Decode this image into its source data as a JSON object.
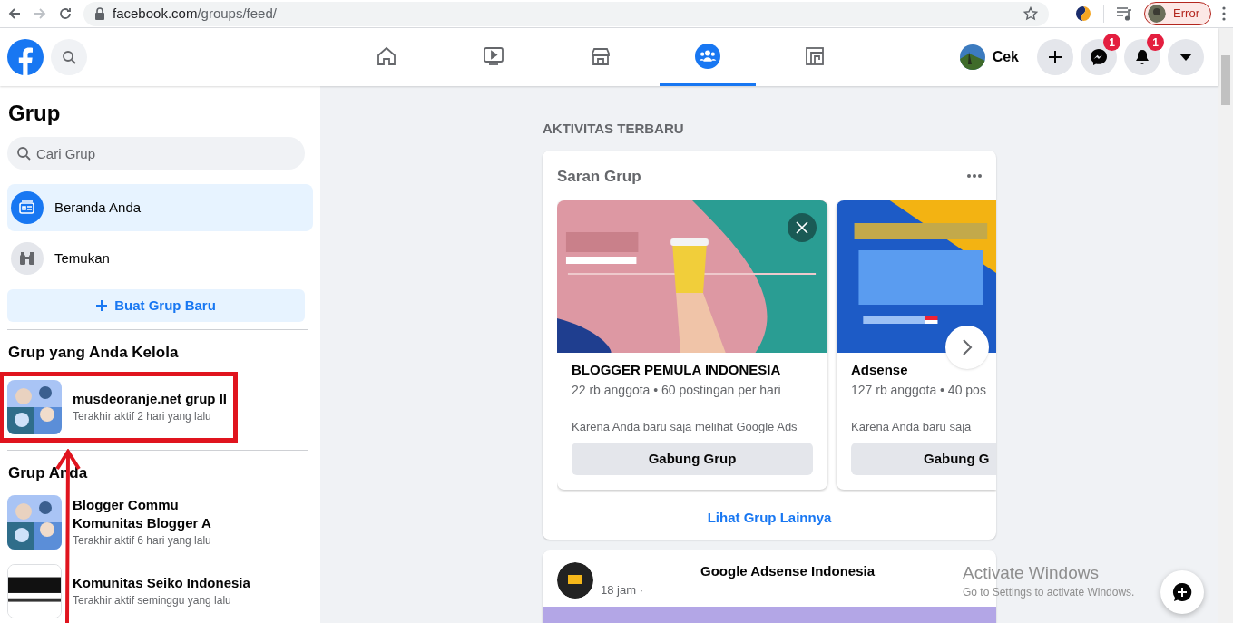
{
  "browser": {
    "url_host": "facebook.com",
    "url_path": "/groups/feed/",
    "profile_label": "Error"
  },
  "header": {
    "nav": [
      {
        "kind": "home",
        "selected": false
      },
      {
        "kind": "video",
        "selected": false
      },
      {
        "kind": "store",
        "selected": false
      },
      {
        "kind": "groups",
        "selected": true
      },
      {
        "kind": "gaming",
        "selected": false
      }
    ],
    "user_name": "Cek",
    "messenger_badge": "1",
    "notification_badge": "1"
  },
  "sidebar": {
    "title": "Grup",
    "search": {
      "placeholder": "Cari Grup"
    },
    "items": [
      {
        "kind": "feed",
        "label": "Beranda Anda",
        "selected": true
      },
      {
        "kind": "discover",
        "label": "Temukan",
        "selected": false
      }
    ],
    "create_button": "Buat Grup Baru",
    "sections": [
      {
        "title": "Grup yang Anda Kelola",
        "highlighted": true,
        "groups": [
          {
            "kind": "people",
            "name": "musdeoranje.net grup II",
            "activity": "Terakhir aktif 2 hari yang lalu"
          }
        ]
      },
      {
        "title": "Grup Anda",
        "highlighted": false,
        "groups": [
          {
            "kind": "people",
            "name": "Blogger Commu",
            "name_2": "Komunitas Blogger A",
            "activity": "Terakhir aktif 6 hari yang lalu"
          },
          {
            "kind": "logo",
            "name": "Komunitas Seiko Indonesia",
            "activity": "Terakhir aktif seminggu yang lalu"
          }
        ]
      }
    ]
  },
  "main": {
    "section_title": "AKTIVITAS TERBARU",
    "suggestions": {
      "title": "Saran Grup",
      "cards": [
        {
          "kind": "coffee",
          "name": "BLOGGER PEMULA INDONESIA",
          "meta": "22 rb anggota • 60 postingan per hari",
          "reason": "Karena Anda baru saja melihat Google Ads",
          "button": "Gabung Grup"
        },
        {
          "kind": "seo",
          "name": "Adsense",
          "meta": "127 rb anggota • 40 pos",
          "reason": "Karena Anda baru saja",
          "button": "Gabung G"
        }
      ],
      "more_link": "Lihat Grup Lainnya"
    },
    "post": {
      "group": "Google Adsense Indonesia",
      "time": "18 jam ·"
    }
  },
  "watermark_os": {
    "title": "Activate Windows",
    "subtitle": "Go to Settings to activate Windows."
  }
}
